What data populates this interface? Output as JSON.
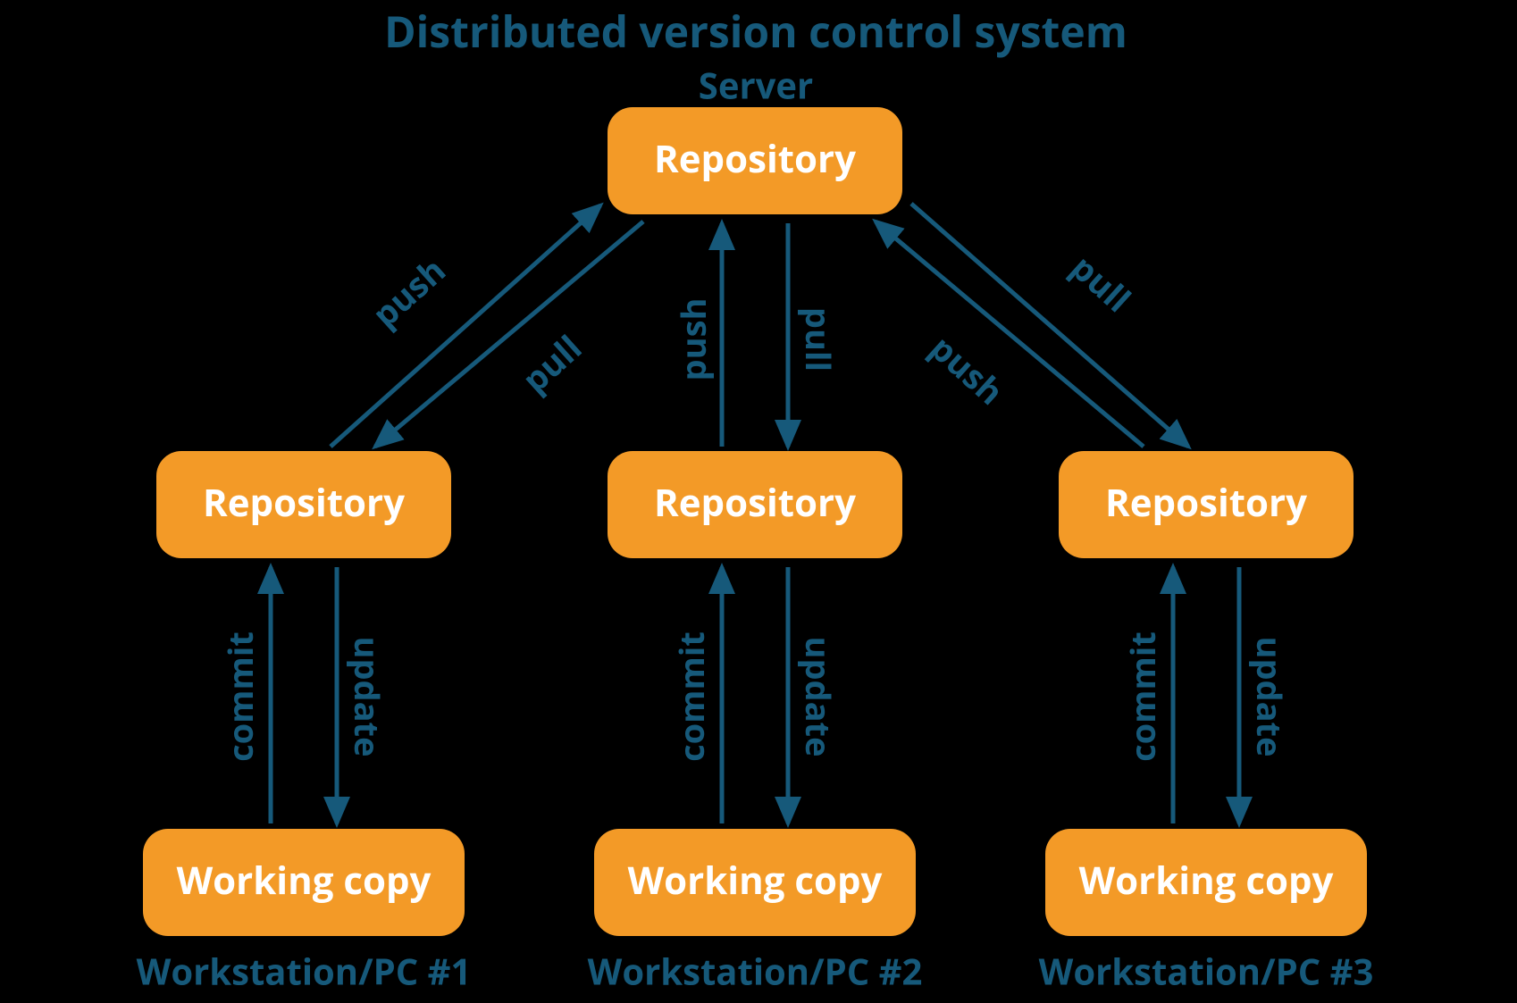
{
  "colors": {
    "background": "#000000",
    "node_fill": "#f39a27",
    "node_text": "#ffffff",
    "line": "#16597a",
    "label": "#16597a"
  },
  "title": "Distributed version control system",
  "server_label": "Server",
  "nodes": {
    "server_repo": "Repository",
    "ws1_repo": "Repository",
    "ws2_repo": "Repository",
    "ws3_repo": "Repository",
    "ws1_wc": "Working copy",
    "ws2_wc": "Working copy",
    "ws3_wc": "Working copy"
  },
  "workstation_labels": {
    "ws1": "Workstation/PC #1",
    "ws2": "Workstation/PC #2",
    "ws3": "Workstation/PC #3"
  },
  "operations": {
    "push": "push",
    "pull": "pull",
    "commit": "commit",
    "update": "update"
  }
}
